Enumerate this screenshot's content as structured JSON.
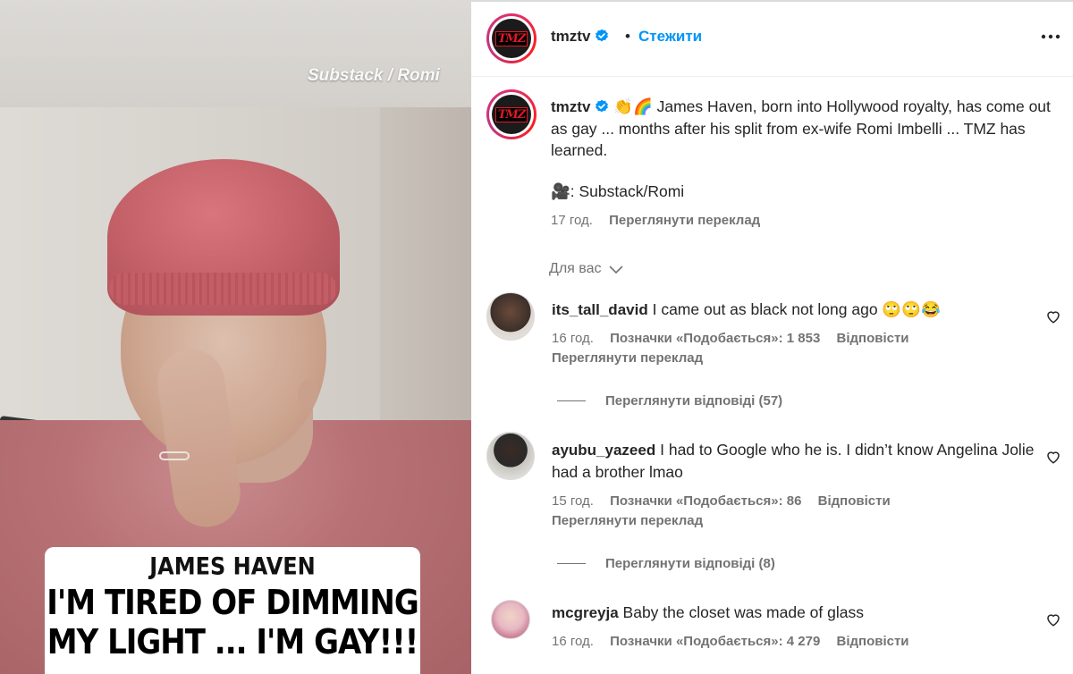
{
  "media": {
    "watermark": "Substack / Romi",
    "caption_line1": "JAMES HAVEN",
    "caption_line2": "I'M TIRED OF DIMMING",
    "caption_line3": "MY LIGHT ... I'M GAY!!!"
  },
  "header": {
    "avatar_text": "TMZ",
    "username": "tmztv",
    "dot": "•",
    "follow_label": "Стежити",
    "more_icon": "more-horizontal-icon"
  },
  "post": {
    "username": "tmztv",
    "caption": "👏🌈 James Haven, born into Hollywood royalty, has come out as gay ... months after his split from ex-wife Romi Imbelli ... TMZ has learned.",
    "credit": "🎥: Substack/Romi",
    "time": "17 год.",
    "translate_label": "Переглянути переклад"
  },
  "section": {
    "for_you": "Для вас"
  },
  "comments": [
    {
      "username": "its_tall_david",
      "text": "I came out as black not long ago 🙄🙄😂",
      "time": "16 год.",
      "likes": "Позначки «Подобається»: 1 853",
      "reply": "Відповісти",
      "translate": "Переглянути переклад",
      "replies": "Переглянути відповіді (57)",
      "avatar_color": "#3b2f2a"
    },
    {
      "username": "ayubu_yazeed",
      "text": "I had to Google who he is. I didn’t know Angelina Jolie had a brother lmao",
      "time": "15 год.",
      "likes": "Позначки «Подобається»: 86",
      "reply": "Відповісти",
      "translate": "Переглянути переклад",
      "replies": "Переглянути відповіді (8)",
      "avatar_color": "#2a2a2a"
    },
    {
      "username": "mcgreyja",
      "text": "Baby the closet was made of glass",
      "time": "16 год.",
      "likes": "Позначки «Подобається»: 4 279",
      "reply": "Відповісти",
      "avatar_color": "#e7b9c4"
    }
  ],
  "colors": {
    "link_blue": "#0095f6",
    "muted": "#737373",
    "verified_blue": "#0095f6",
    "tmz_red": "#e11a22"
  }
}
